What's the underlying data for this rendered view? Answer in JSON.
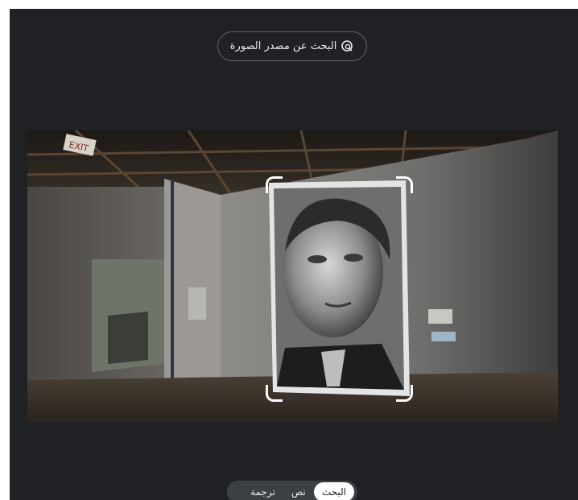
{
  "header": {
    "source_button_label": "البحث عن مصدر الصورة",
    "source_button_icon": "image-search-icon"
  },
  "image": {
    "description_exit_sign": "EXIT"
  },
  "tabs": [
    {
      "label": "البحث",
      "active": true
    },
    {
      "label": "نص",
      "active": false
    },
    {
      "label": "ترجمة",
      "active": false
    }
  ],
  "colors": {
    "background": "#202124",
    "outline": "#5f6368",
    "text": "#e8eaed",
    "tab_bg": "#3c4043",
    "active_tab": "#ffffff"
  }
}
